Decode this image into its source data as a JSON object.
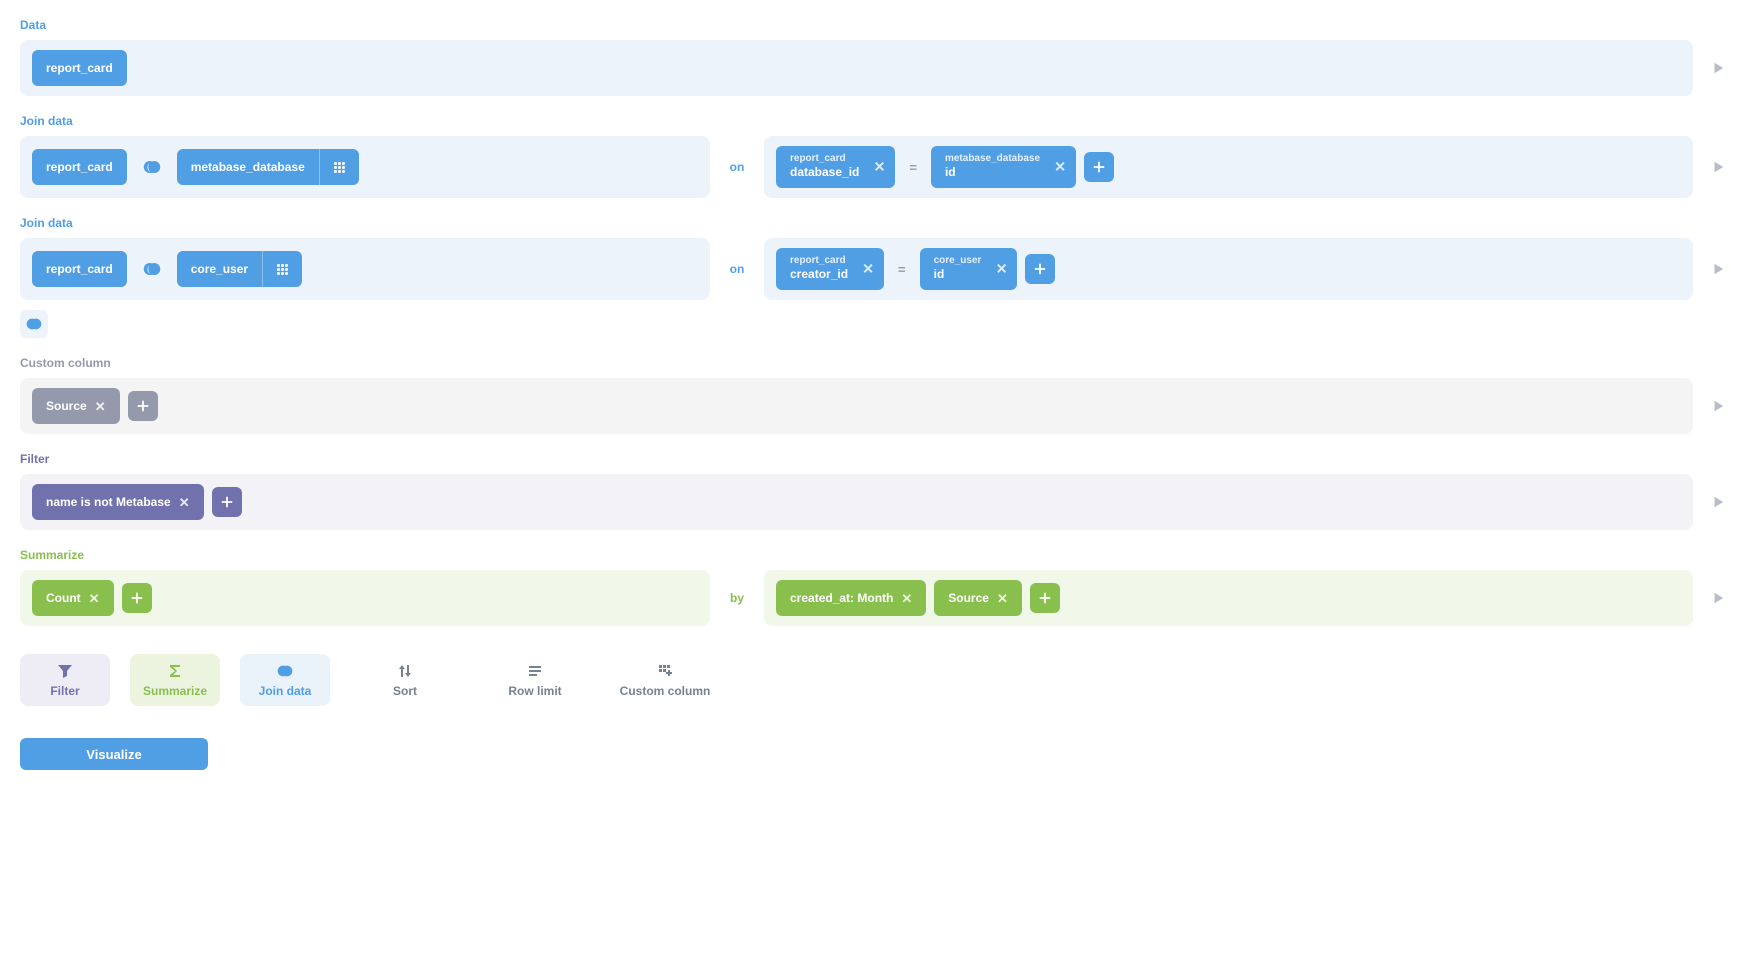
{
  "data": {
    "label": "Data",
    "table": "report_card"
  },
  "joins": [
    {
      "label": "Join data",
      "left_table": "report_card",
      "right_table": "metabase_database",
      "on_label": "on",
      "equals": "=",
      "left_field": {
        "table": "report_card",
        "column": "database_id"
      },
      "right_field": {
        "table": "metabase_database",
        "column": "id"
      }
    },
    {
      "label": "Join data",
      "left_table": "report_card",
      "right_table": "core_user",
      "on_label": "on",
      "equals": "=",
      "left_field": {
        "table": "report_card",
        "column": "creator_id"
      },
      "right_field": {
        "table": "core_user",
        "column": "id"
      }
    }
  ],
  "custom_column": {
    "label": "Custom column",
    "columns": [
      "Source"
    ]
  },
  "filter": {
    "label": "Filter",
    "filters": [
      "name is not Metabase"
    ]
  },
  "summarize": {
    "label": "Summarize",
    "metrics": [
      "Count"
    ],
    "by_label": "by",
    "groupings": [
      "created_at: Month",
      "Source"
    ]
  },
  "actions": {
    "filter": "Filter",
    "summarize": "Summarize",
    "join": "Join data",
    "sort": "Sort",
    "row_limit": "Row limit",
    "custom_column": "Custom column"
  },
  "visualize": "Visualize"
}
